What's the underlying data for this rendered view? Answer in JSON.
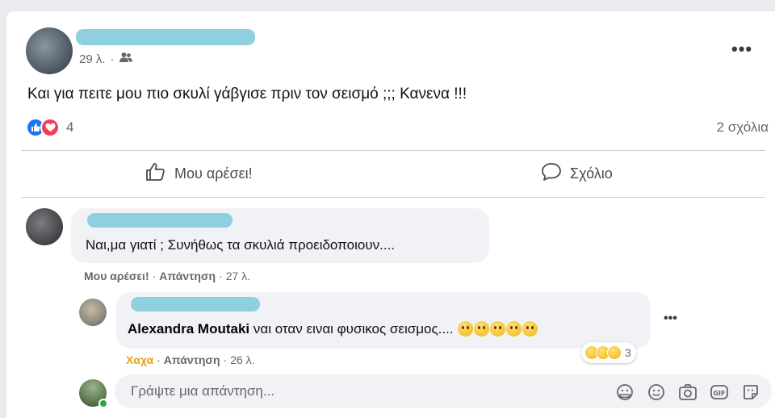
{
  "post": {
    "time": "29 λ.",
    "meta_sep": "·",
    "text": "Και για πειτε μου πιο σκυλί γάβγισε πριν τον σεισμό ;;; Κανενα !!!",
    "reaction_count": "4",
    "comments_count": "2 σχόλια",
    "more": "•••"
  },
  "actions": {
    "like": "Μου αρέσει!",
    "comment": "Σχόλιο"
  },
  "comments": [
    {
      "text": "Ναι,μα γιατί ; Συνήθως τα σκυλιά προειδοποιουν....",
      "like_label": "Μου αρέσει!",
      "reply_label": "Απάντηση",
      "time": "27 λ."
    }
  ],
  "reply": {
    "tagged_name": "Alexandra Moutaki",
    "text": "ναι οταν ειναι φυσικος σεισμος....",
    "reaction_label": "Χαχα",
    "reply_label": "Απάντηση",
    "time": "26 λ.",
    "reaction_count": "3",
    "more": "•••"
  },
  "reply_box": {
    "placeholder": "Γράψτε μια απάντηση..."
  },
  "colors": {
    "accent": "#1877f2",
    "love": "#f33e58",
    "haha": "#e7a01a",
    "redaction": "#8ecfe0"
  }
}
